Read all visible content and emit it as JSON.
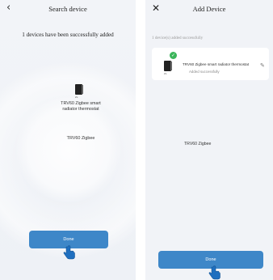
{
  "left": {
    "title": "Search device",
    "message": "1 devices have been successfully added",
    "device_name_line1": "TRV60 Zigbee smart",
    "device_name_line2": "radiator thermostat",
    "ring_label": "TRV60 Zigbee",
    "done_label": "Done",
    "back_icon": "chevron-left-icon"
  },
  "right": {
    "title": "Add Device",
    "subtitle": "1 device(s) added successfully",
    "card": {
      "device_name": "TRV60 Zigbee smart radiator thermostat",
      "status": "Added successfully"
    },
    "ring_label": "TRV60 Zigbee",
    "done_label": "Done",
    "close_icon": "close-icon"
  },
  "colors": {
    "accent": "#3e87c8",
    "success": "#3bb55a",
    "background": "#f1f3f7"
  }
}
